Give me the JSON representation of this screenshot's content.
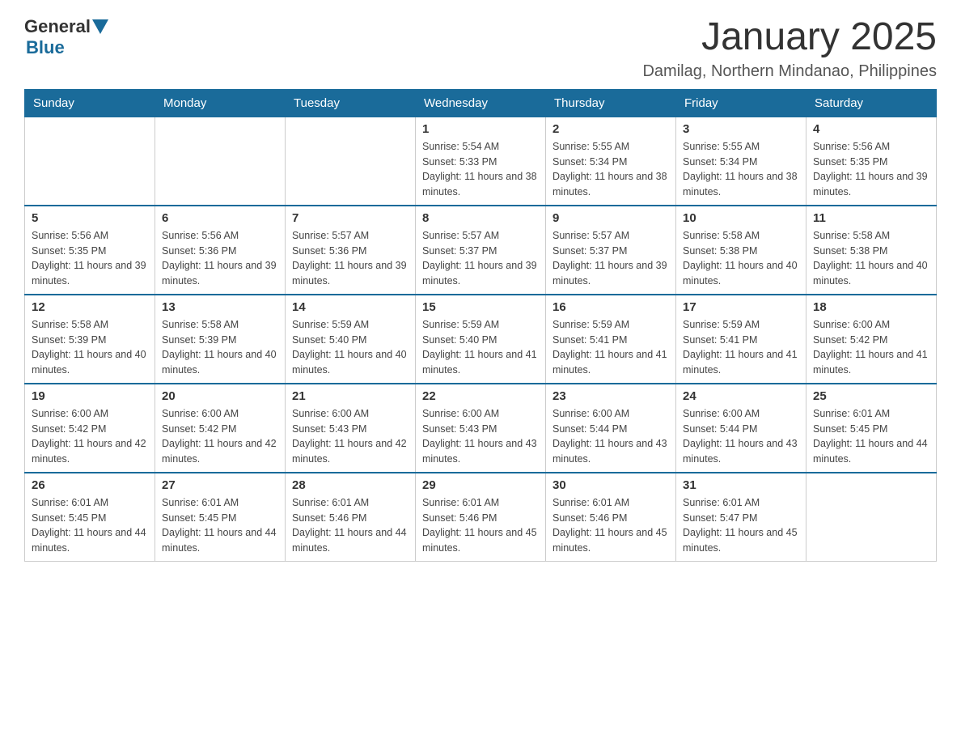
{
  "header": {
    "logo_general": "General",
    "logo_blue": "Blue",
    "month_title": "January 2025",
    "location": "Damilag, Northern Mindanao, Philippines"
  },
  "days_of_week": [
    "Sunday",
    "Monday",
    "Tuesday",
    "Wednesday",
    "Thursday",
    "Friday",
    "Saturday"
  ],
  "weeks": [
    [
      {
        "day": "",
        "sunrise": "",
        "sunset": "",
        "daylight": ""
      },
      {
        "day": "",
        "sunrise": "",
        "sunset": "",
        "daylight": ""
      },
      {
        "day": "",
        "sunrise": "",
        "sunset": "",
        "daylight": ""
      },
      {
        "day": "1",
        "sunrise": "Sunrise: 5:54 AM",
        "sunset": "Sunset: 5:33 PM",
        "daylight": "Daylight: 11 hours and 38 minutes."
      },
      {
        "day": "2",
        "sunrise": "Sunrise: 5:55 AM",
        "sunset": "Sunset: 5:34 PM",
        "daylight": "Daylight: 11 hours and 38 minutes."
      },
      {
        "day": "3",
        "sunrise": "Sunrise: 5:55 AM",
        "sunset": "Sunset: 5:34 PM",
        "daylight": "Daylight: 11 hours and 38 minutes."
      },
      {
        "day": "4",
        "sunrise": "Sunrise: 5:56 AM",
        "sunset": "Sunset: 5:35 PM",
        "daylight": "Daylight: 11 hours and 39 minutes."
      }
    ],
    [
      {
        "day": "5",
        "sunrise": "Sunrise: 5:56 AM",
        "sunset": "Sunset: 5:35 PM",
        "daylight": "Daylight: 11 hours and 39 minutes."
      },
      {
        "day": "6",
        "sunrise": "Sunrise: 5:56 AM",
        "sunset": "Sunset: 5:36 PM",
        "daylight": "Daylight: 11 hours and 39 minutes."
      },
      {
        "day": "7",
        "sunrise": "Sunrise: 5:57 AM",
        "sunset": "Sunset: 5:36 PM",
        "daylight": "Daylight: 11 hours and 39 minutes."
      },
      {
        "day": "8",
        "sunrise": "Sunrise: 5:57 AM",
        "sunset": "Sunset: 5:37 PM",
        "daylight": "Daylight: 11 hours and 39 minutes."
      },
      {
        "day": "9",
        "sunrise": "Sunrise: 5:57 AM",
        "sunset": "Sunset: 5:37 PM",
        "daylight": "Daylight: 11 hours and 39 minutes."
      },
      {
        "day": "10",
        "sunrise": "Sunrise: 5:58 AM",
        "sunset": "Sunset: 5:38 PM",
        "daylight": "Daylight: 11 hours and 40 minutes."
      },
      {
        "day": "11",
        "sunrise": "Sunrise: 5:58 AM",
        "sunset": "Sunset: 5:38 PM",
        "daylight": "Daylight: 11 hours and 40 minutes."
      }
    ],
    [
      {
        "day": "12",
        "sunrise": "Sunrise: 5:58 AM",
        "sunset": "Sunset: 5:39 PM",
        "daylight": "Daylight: 11 hours and 40 minutes."
      },
      {
        "day": "13",
        "sunrise": "Sunrise: 5:58 AM",
        "sunset": "Sunset: 5:39 PM",
        "daylight": "Daylight: 11 hours and 40 minutes."
      },
      {
        "day": "14",
        "sunrise": "Sunrise: 5:59 AM",
        "sunset": "Sunset: 5:40 PM",
        "daylight": "Daylight: 11 hours and 40 minutes."
      },
      {
        "day": "15",
        "sunrise": "Sunrise: 5:59 AM",
        "sunset": "Sunset: 5:40 PM",
        "daylight": "Daylight: 11 hours and 41 minutes."
      },
      {
        "day": "16",
        "sunrise": "Sunrise: 5:59 AM",
        "sunset": "Sunset: 5:41 PM",
        "daylight": "Daylight: 11 hours and 41 minutes."
      },
      {
        "day": "17",
        "sunrise": "Sunrise: 5:59 AM",
        "sunset": "Sunset: 5:41 PM",
        "daylight": "Daylight: 11 hours and 41 minutes."
      },
      {
        "day": "18",
        "sunrise": "Sunrise: 6:00 AM",
        "sunset": "Sunset: 5:42 PM",
        "daylight": "Daylight: 11 hours and 41 minutes."
      }
    ],
    [
      {
        "day": "19",
        "sunrise": "Sunrise: 6:00 AM",
        "sunset": "Sunset: 5:42 PM",
        "daylight": "Daylight: 11 hours and 42 minutes."
      },
      {
        "day": "20",
        "sunrise": "Sunrise: 6:00 AM",
        "sunset": "Sunset: 5:42 PM",
        "daylight": "Daylight: 11 hours and 42 minutes."
      },
      {
        "day": "21",
        "sunrise": "Sunrise: 6:00 AM",
        "sunset": "Sunset: 5:43 PM",
        "daylight": "Daylight: 11 hours and 42 minutes."
      },
      {
        "day": "22",
        "sunrise": "Sunrise: 6:00 AM",
        "sunset": "Sunset: 5:43 PM",
        "daylight": "Daylight: 11 hours and 43 minutes."
      },
      {
        "day": "23",
        "sunrise": "Sunrise: 6:00 AM",
        "sunset": "Sunset: 5:44 PM",
        "daylight": "Daylight: 11 hours and 43 minutes."
      },
      {
        "day": "24",
        "sunrise": "Sunrise: 6:00 AM",
        "sunset": "Sunset: 5:44 PM",
        "daylight": "Daylight: 11 hours and 43 minutes."
      },
      {
        "day": "25",
        "sunrise": "Sunrise: 6:01 AM",
        "sunset": "Sunset: 5:45 PM",
        "daylight": "Daylight: 11 hours and 44 minutes."
      }
    ],
    [
      {
        "day": "26",
        "sunrise": "Sunrise: 6:01 AM",
        "sunset": "Sunset: 5:45 PM",
        "daylight": "Daylight: 11 hours and 44 minutes."
      },
      {
        "day": "27",
        "sunrise": "Sunrise: 6:01 AM",
        "sunset": "Sunset: 5:45 PM",
        "daylight": "Daylight: 11 hours and 44 minutes."
      },
      {
        "day": "28",
        "sunrise": "Sunrise: 6:01 AM",
        "sunset": "Sunset: 5:46 PM",
        "daylight": "Daylight: 11 hours and 44 minutes."
      },
      {
        "day": "29",
        "sunrise": "Sunrise: 6:01 AM",
        "sunset": "Sunset: 5:46 PM",
        "daylight": "Daylight: 11 hours and 45 minutes."
      },
      {
        "day": "30",
        "sunrise": "Sunrise: 6:01 AM",
        "sunset": "Sunset: 5:46 PM",
        "daylight": "Daylight: 11 hours and 45 minutes."
      },
      {
        "day": "31",
        "sunrise": "Sunrise: 6:01 AM",
        "sunset": "Sunset: 5:47 PM",
        "daylight": "Daylight: 11 hours and 45 minutes."
      },
      {
        "day": "",
        "sunrise": "",
        "sunset": "",
        "daylight": ""
      }
    ]
  ]
}
